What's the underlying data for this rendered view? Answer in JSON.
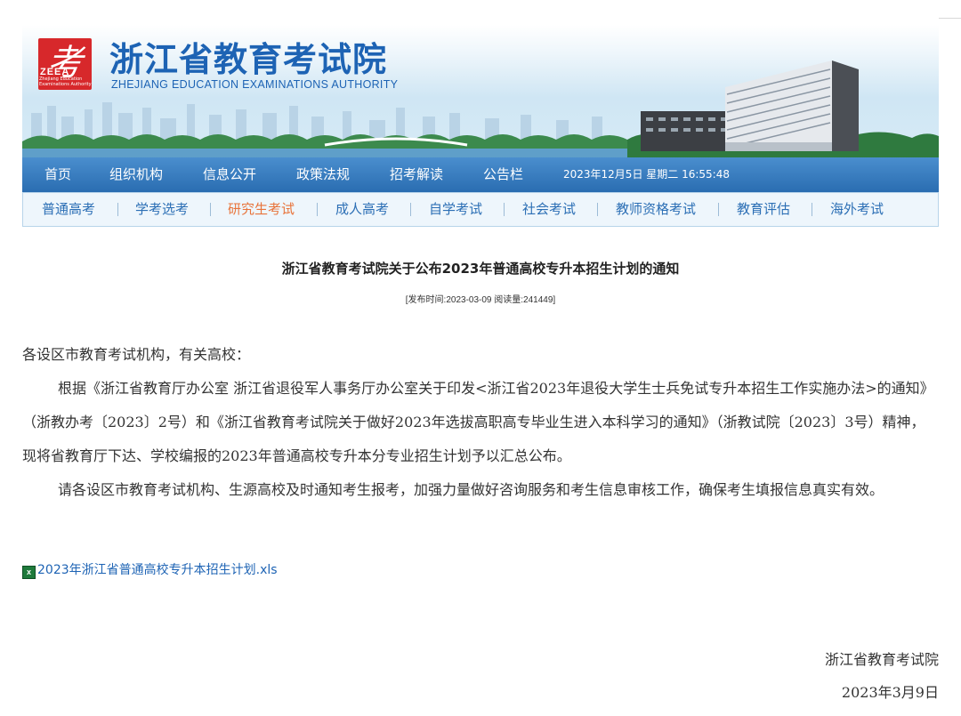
{
  "header": {
    "logo_char": "考",
    "logo_abbr": "ZEEA",
    "logo_sub": "Zhejiang Education Examinations Authority",
    "title": "浙江省教育考试院",
    "title_en": "ZHEJIANG EDUCATION EXAMINATIONS AUTHORITY"
  },
  "nav_main": {
    "items": [
      {
        "label": "首页"
      },
      {
        "label": "组织机构"
      },
      {
        "label": "信息公开"
      },
      {
        "label": "政策法规"
      },
      {
        "label": "招考解读"
      },
      {
        "label": "公告栏"
      }
    ],
    "datetime": "2023年12月5日 星期二 16:55:48"
  },
  "nav_sub": {
    "items": [
      {
        "label": "普通高考"
      },
      {
        "label": "学考选考"
      },
      {
        "label": "研究生考试"
      },
      {
        "label": "成人高考"
      },
      {
        "label": "自学考试"
      },
      {
        "label": "社会考试"
      },
      {
        "label": "教师资格考试"
      },
      {
        "label": "教育评估"
      },
      {
        "label": "海外考试"
      }
    ],
    "active_color": "#e8743b"
  },
  "article": {
    "title": "浙江省教育考试院关于公布2023年普通高校专升本招生计划的通知",
    "meta": "[发布时间:2023-03-09 阅读量:241449]",
    "greeting": "各设区市教育考试机构，有关高校：",
    "para1": "根据《浙江省教育厅办公室 浙江省退役军人事务厅办公室关于印发<浙江省2023年退役大学生士兵免试专升本招生工作实施办法>的通知》（浙教办考〔2023〕2号）和《浙江省教育考试院关于做好2023年选拔高职高专毕业生进入本科学习的通知》（浙教试院〔2023〕3号）精神，现将省教育厅下达、学校编报的2023年普通高校专升本分专业招生计划予以汇总公布。",
    "para2": "请各设区市教育考试机构、生源高校及时通知考生报考，加强力量做好咨询服务和考生信息审核工作，确保考生填报信息真实有效。",
    "attachment": "2023年浙江省普通高校专升本招生计划.xls",
    "signature": "浙江省教育考试院",
    "date": "2023年3月9日"
  },
  "colors": {
    "brand_blue": "#1d63b4",
    "logo_red": "#d7282b"
  }
}
